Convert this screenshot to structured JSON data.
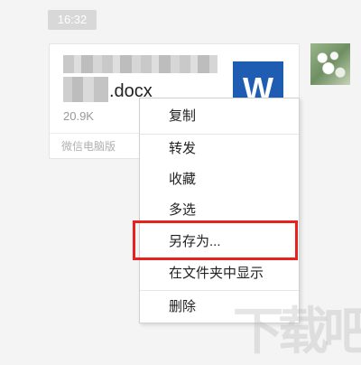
{
  "chat": {
    "timestamp": "16:32"
  },
  "file_message": {
    "extension": ".docx",
    "size": "20.9K",
    "source": "微信电脑版",
    "icon_letter": "W",
    "icon_color": "#1f5db2"
  },
  "context_menu": {
    "items": [
      {
        "label": "复制"
      },
      {
        "label": "转发"
      },
      {
        "label": "收藏"
      },
      {
        "label": "多选"
      },
      {
        "label": "另存为..."
      },
      {
        "label": "在文件夹中显示"
      },
      {
        "label": "删除"
      }
    ],
    "highlighted_item": "另存为...",
    "highlight_color": "#e8201e"
  },
  "watermark": {
    "text": "下载吧"
  }
}
